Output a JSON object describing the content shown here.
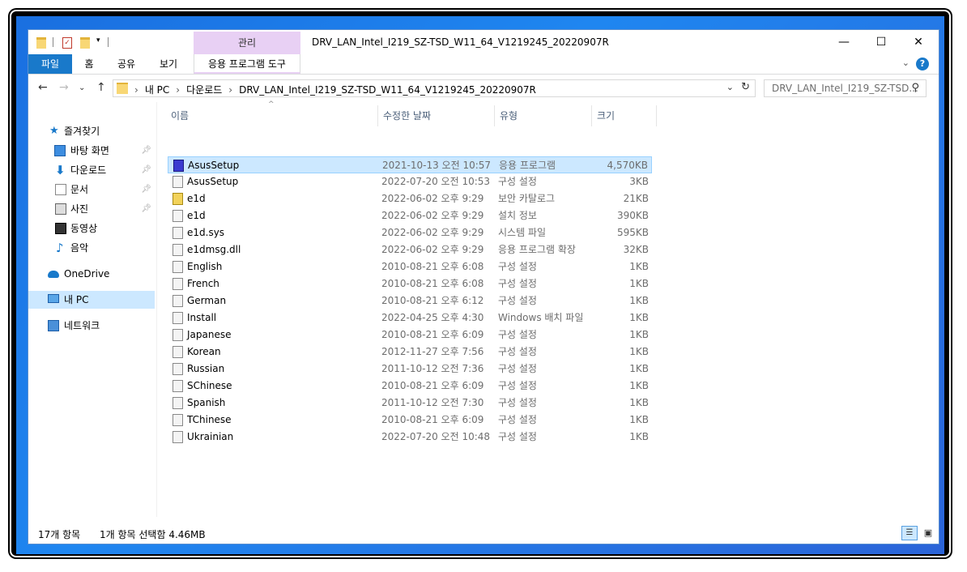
{
  "window": {
    "title": "DRV_LAN_Intel_I219_SZ-TSD_W11_64_V1219245_20220907R",
    "context_tab_group": "관리",
    "minimize": "—",
    "maximize": "☐",
    "close": "✕"
  },
  "ribbon": {
    "tabs": [
      "파일",
      "홈",
      "공유",
      "보기",
      "응용 프로그램 도구"
    ],
    "help": "?",
    "toggle": "⌄"
  },
  "address": {
    "crumbs": [
      "내 PC",
      "다운로드",
      "DRV_LAN_Intel_I219_SZ-TSD_W11_64_V1219245_20220907R"
    ],
    "crumb_prefix": "›",
    "search_placeholder": "DRV_LAN_Intel_I219_SZ-TSD..."
  },
  "nav": {
    "quick_access": "즐겨찾기",
    "items": [
      "바탕 화면",
      "다운로드",
      "문서",
      "사진",
      "동영상",
      "음악"
    ],
    "onedrive": "OneDrive",
    "this_pc": "내 PC",
    "network": "네트워크"
  },
  "columns": {
    "name": "이름",
    "date": "수정한 날짜",
    "type": "유형",
    "size": "크기"
  },
  "files": [
    {
      "name": "AsusSetup",
      "date": "2021-10-13 오전 10:57",
      "type": "응용 프로그램",
      "size": "4,570KB",
      "icon": "app-icon",
      "selected": true
    },
    {
      "name": "AsusSetup",
      "date": "2022-07-20 오전 10:53",
      "type": "구성 설정",
      "size": "3KB",
      "icon": "settings-file-icon"
    },
    {
      "name": "e1d",
      "date": "2022-06-02 오후 9:29",
      "type": "보안 카탈로그",
      "size": "21KB",
      "icon": "catalog-icon"
    },
    {
      "name": "e1d",
      "date": "2022-06-02 오후 9:29",
      "type": "설치 정보",
      "size": "390KB",
      "icon": "setup-info-icon"
    },
    {
      "name": "e1d.sys",
      "date": "2022-06-02 오후 9:29",
      "type": "시스템 파일",
      "size": "595KB",
      "icon": "system-file-icon"
    },
    {
      "name": "e1dmsg.dll",
      "date": "2022-06-02 오후 9:29",
      "type": "응용 프로그램 확장",
      "size": "32KB",
      "icon": "dll-icon"
    },
    {
      "name": "English",
      "date": "2010-08-21 오후 6:08",
      "type": "구성 설정",
      "size": "1KB",
      "icon": "settings-file-icon"
    },
    {
      "name": "French",
      "date": "2010-08-21 오후 6:08",
      "type": "구성 설정",
      "size": "1KB",
      "icon": "settings-file-icon"
    },
    {
      "name": "German",
      "date": "2010-08-21 오후 6:12",
      "type": "구성 설정",
      "size": "1KB",
      "icon": "settings-file-icon"
    },
    {
      "name": "Install",
      "date": "2022-04-25 오후 4:30",
      "type": "Windows 배치 파일",
      "size": "1KB",
      "icon": "batch-file-icon"
    },
    {
      "name": "Japanese",
      "date": "2010-08-21 오후 6:09",
      "type": "구성 설정",
      "size": "1KB",
      "icon": "settings-file-icon"
    },
    {
      "name": "Korean",
      "date": "2012-11-27 오후 7:56",
      "type": "구성 설정",
      "size": "1KB",
      "icon": "settings-file-icon"
    },
    {
      "name": "Russian",
      "date": "2011-10-12 오전 7:36",
      "type": "구성 설정",
      "size": "1KB",
      "icon": "settings-file-icon"
    },
    {
      "name": "SChinese",
      "date": "2010-08-21 오후 6:09",
      "type": "구성 설정",
      "size": "1KB",
      "icon": "settings-file-icon"
    },
    {
      "name": "Spanish",
      "date": "2011-10-12 오전 7:30",
      "type": "구성 설정",
      "size": "1KB",
      "icon": "settings-file-icon"
    },
    {
      "name": "TChinese",
      "date": "2010-08-21 오후 6:09",
      "type": "구성 설정",
      "size": "1KB",
      "icon": "settings-file-icon"
    },
    {
      "name": "Ukrainian",
      "date": "2022-07-20 오전 10:48",
      "type": "구성 설정",
      "size": "1KB",
      "icon": "settings-file-icon"
    }
  ],
  "status": {
    "count": "17개 항목",
    "selection": "1개 항목 선택함 4.46MB"
  },
  "colors": {
    "accent": "#1979ca",
    "selection": "#cce8ff",
    "context_tab": "#e8d0f4"
  }
}
